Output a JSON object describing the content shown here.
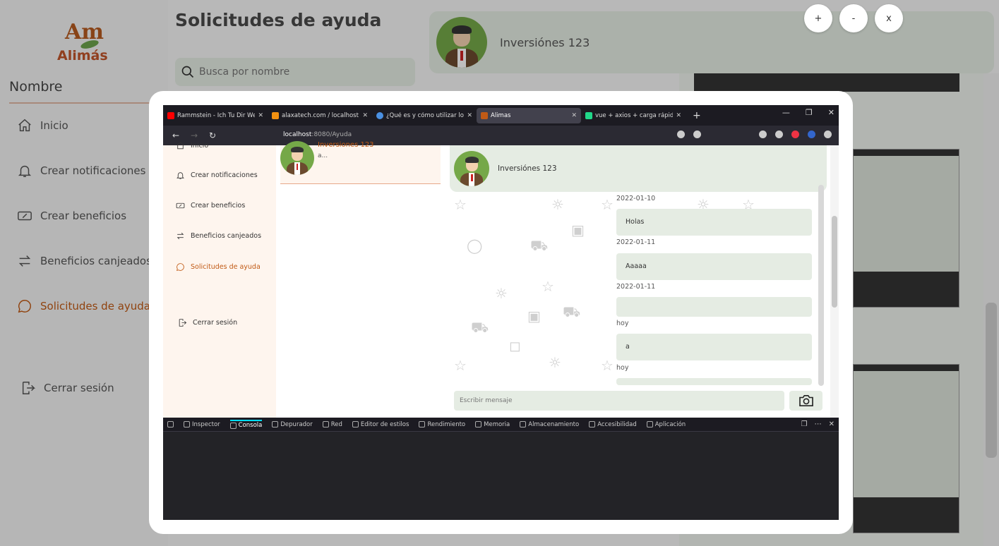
{
  "sidebar": {
    "logo_am": "Am",
    "logo_text": "Alimás",
    "user_name": "Nombre",
    "items": [
      {
        "label": "Inicio",
        "icon": "home-icon"
      },
      {
        "label": "Crear notificaciones",
        "icon": "bell-icon"
      },
      {
        "label": "Crear beneficios",
        "icon": "coupon-icon"
      },
      {
        "label": "Beneficios canjeados",
        "icon": "exchange-icon"
      },
      {
        "label": "Solicitudes de ayuda",
        "icon": "chat-icon",
        "active": true
      }
    ],
    "logout": "Cerrar sesión"
  },
  "page": {
    "title": "Solicitudes de ayuda",
    "search_placeholder": "Busca por nombre",
    "chat_name": "Inversiónes 123"
  },
  "zoom_controls": {
    "zoom_in": "+",
    "zoom_out": "-",
    "close": "x"
  },
  "browser": {
    "tabs": [
      {
        "title": "Rammstein - Ich Tu Dir Weh (O",
        "color": "#ff0000"
      },
      {
        "title": "alaxatech.com / localhost / ala",
        "color": "#f29111"
      },
      {
        "title": "¿Qué es y cómo utilizar localSto",
        "color": "#4a90e2"
      },
      {
        "title": "Alimas",
        "color": "#c15a15",
        "active": true
      },
      {
        "title": "vue + axios + carga rápida de in",
        "color": "#21d789"
      }
    ],
    "new_tab": "+",
    "url_host": "localhost",
    "url_path": ":8080/Ayuda"
  },
  "inner": {
    "nav": [
      {
        "label": "Inicio",
        "icon": "home-icon"
      },
      {
        "label": "Crear notificaciones",
        "icon": "bell-icon"
      },
      {
        "label": "Crear beneficios",
        "icon": "coupon-icon"
      },
      {
        "label": "Beneficios canjeados",
        "icon": "exchange-icon"
      },
      {
        "label": "Solicitudes de ayuda",
        "icon": "chat-icon",
        "active": true
      }
    ],
    "logout": "Cerrar sesión",
    "contact_name": "Inversiones 123",
    "contact_preview": "a...",
    "header_name": "Inversiónes 123",
    "messages": [
      {
        "date": "2022-01-10",
        "text": "Holas"
      },
      {
        "date": "2022-01-11",
        "text": "Aaaaa"
      },
      {
        "date": "2022-01-11",
        "text": ""
      },
      {
        "date": "hoy",
        "text": "a"
      },
      {
        "date": "hoy",
        "text": ""
      }
    ],
    "input_placeholder": "Escribir mensaje"
  },
  "devtools": {
    "tabs": [
      "Inspector",
      "Consola",
      "Depurador",
      "Red",
      "Editor de estilos",
      "Rendimiento",
      "Memoria",
      "Almacenamiento",
      "Accesibilidad",
      "Aplicación"
    ],
    "active": "Consola"
  }
}
